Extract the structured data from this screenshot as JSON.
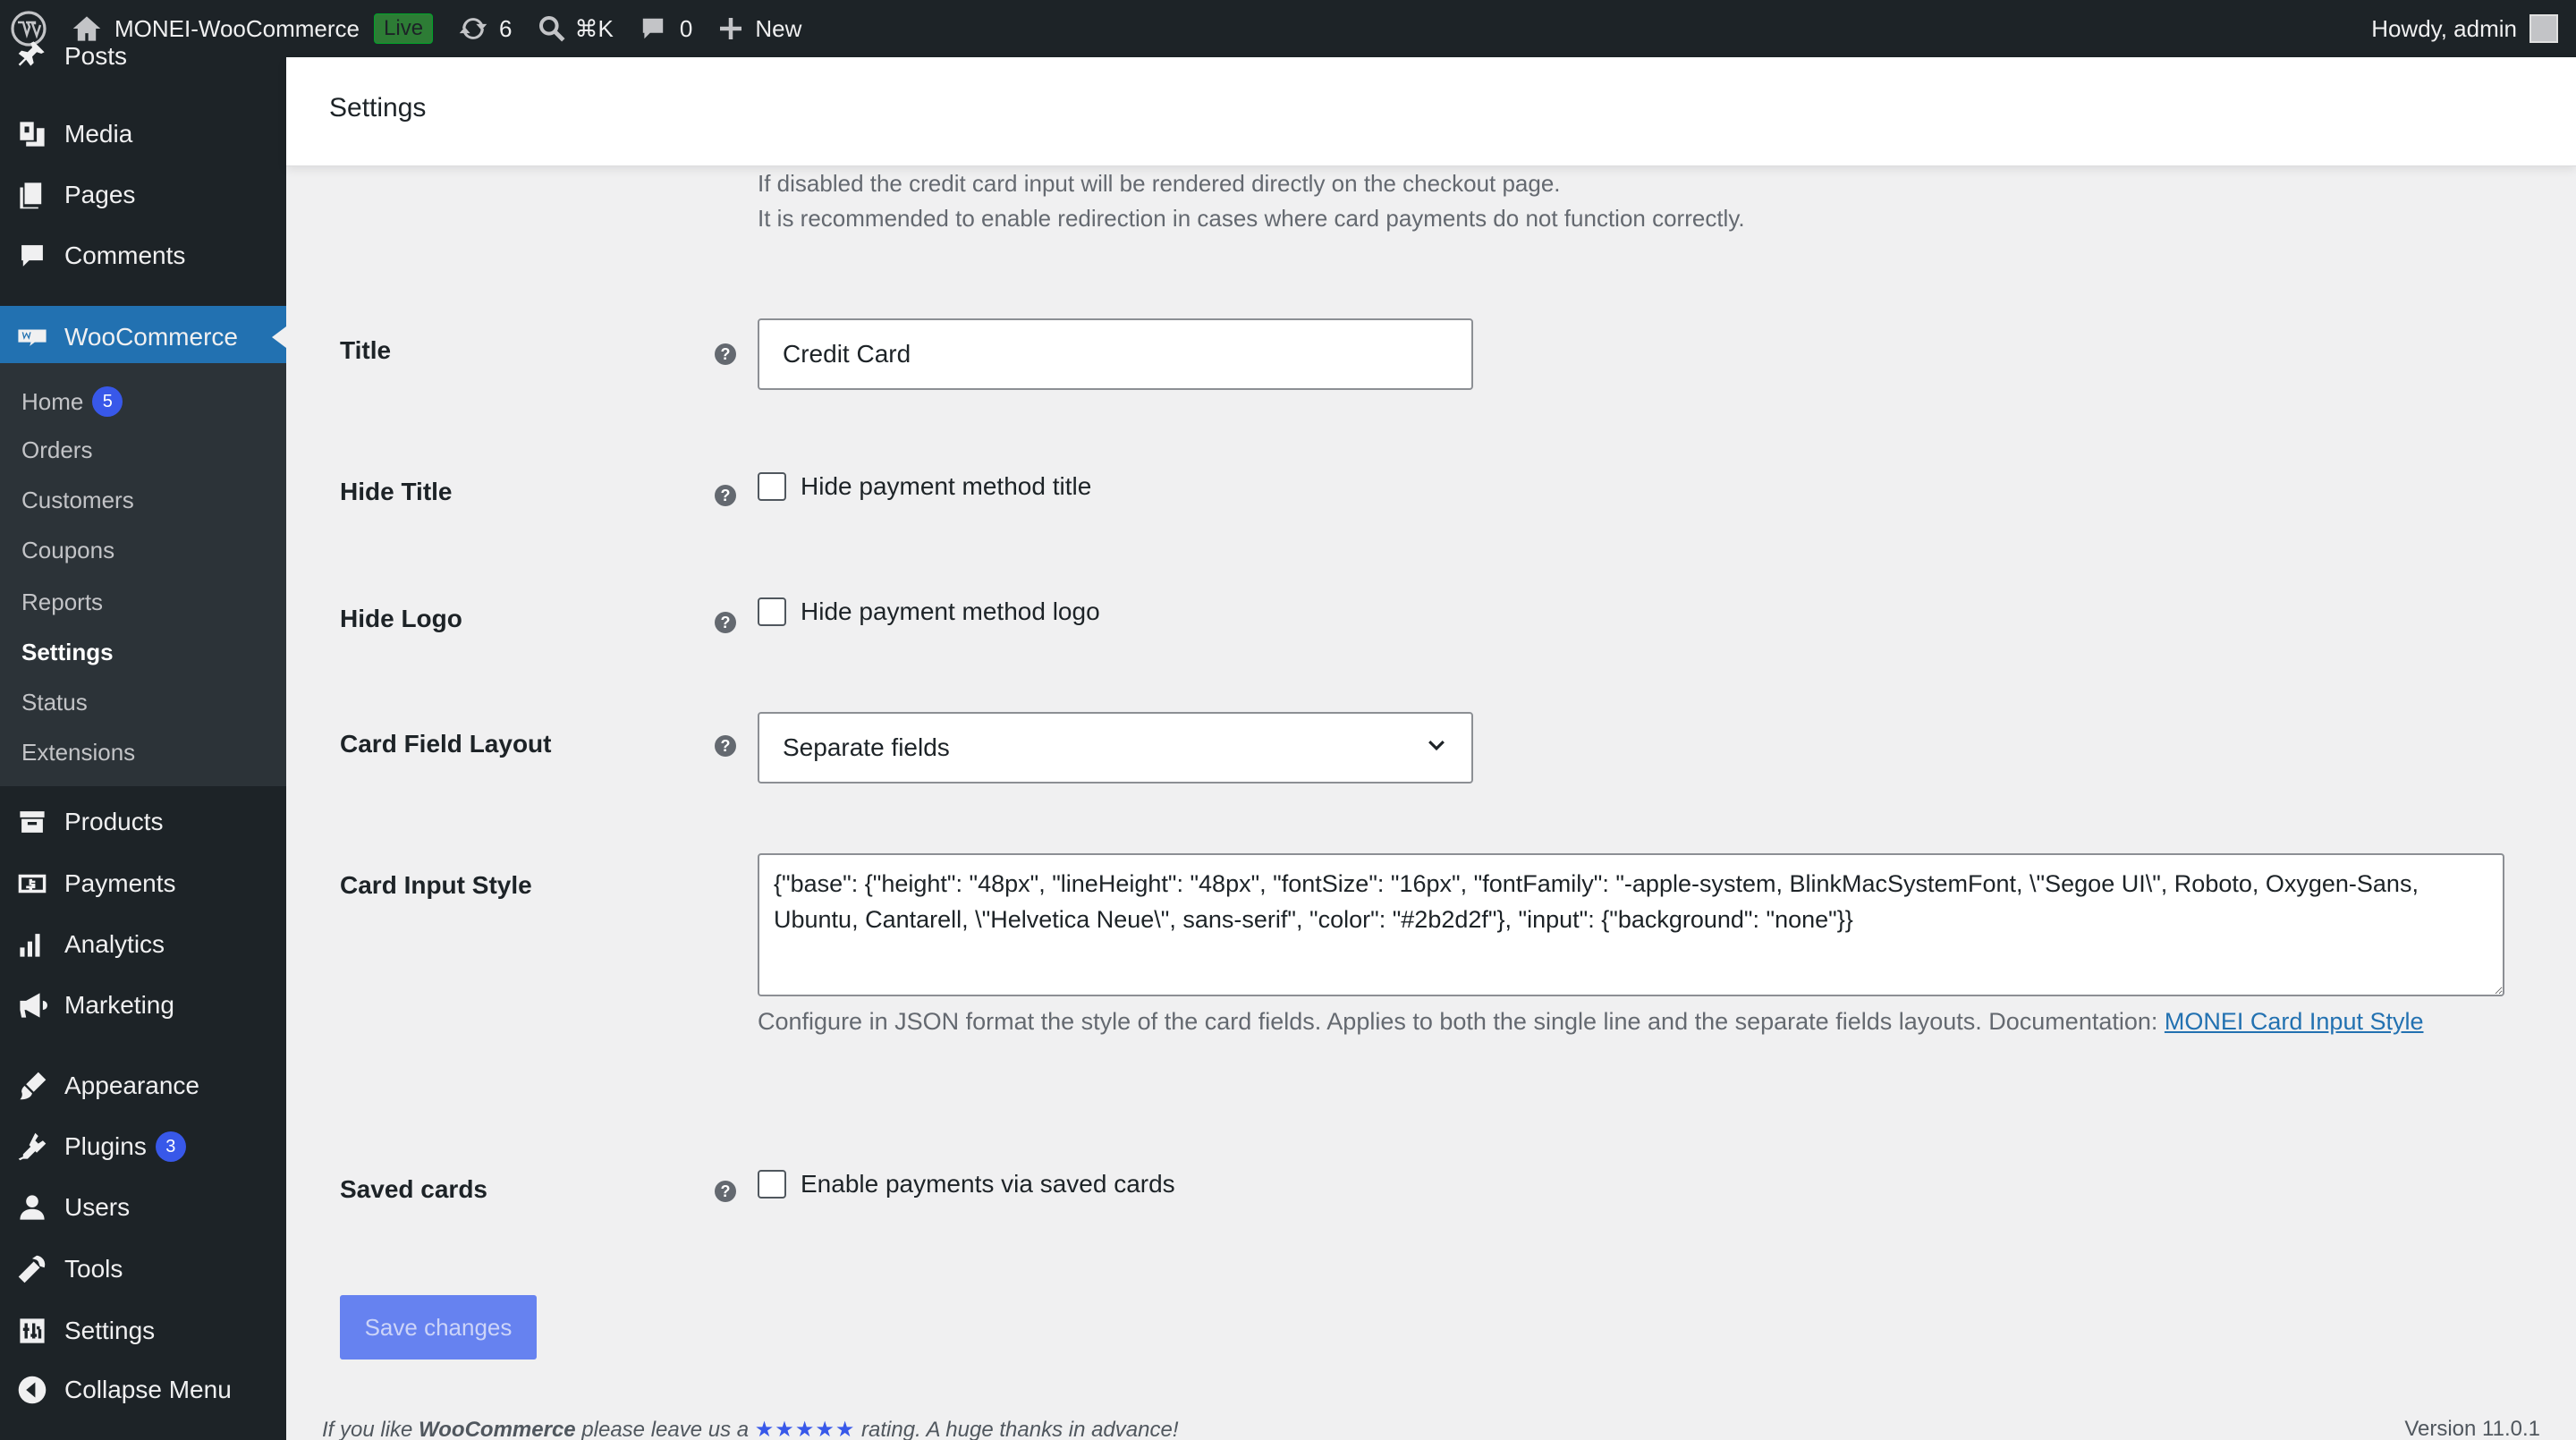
{
  "admin_bar": {
    "site_name": "MONEI-WooCommerce",
    "live_badge": "Live",
    "updates_count": "6",
    "search_shortcut": "⌘K",
    "comments_count": "0",
    "new_label": "New",
    "howdy": "Howdy, admin"
  },
  "sidebar": {
    "items": [
      {
        "label": "Posts",
        "icon": "pin-icon"
      },
      {
        "label": "Media",
        "icon": "media-icon"
      },
      {
        "label": "Pages",
        "icon": "pages-icon"
      },
      {
        "label": "Comments",
        "icon": "comment-icon"
      },
      {
        "label": "WooCommerce",
        "icon": "woo-icon"
      },
      {
        "label": "Products",
        "icon": "archive-icon"
      },
      {
        "label": "Payments",
        "icon": "payments-icon"
      },
      {
        "label": "Analytics",
        "icon": "chart-bar-icon"
      },
      {
        "label": "Marketing",
        "icon": "megaphone-icon"
      },
      {
        "label": "Appearance",
        "icon": "brush-icon"
      },
      {
        "label": "Plugins",
        "icon": "plugin-icon",
        "badge": "3"
      },
      {
        "label": "Users",
        "icon": "users-icon"
      },
      {
        "label": "Tools",
        "icon": "wrench-icon"
      },
      {
        "label": "Settings",
        "icon": "settings-icon"
      },
      {
        "label": "Collapse Menu",
        "icon": "collapse-icon"
      }
    ],
    "submenu": [
      {
        "label": "Home",
        "badge": "5"
      },
      {
        "label": "Orders"
      },
      {
        "label": "Customers"
      },
      {
        "label": "Coupons"
      },
      {
        "label": "Reports"
      },
      {
        "label": "Settings"
      },
      {
        "label": "Status"
      },
      {
        "label": "Extensions"
      }
    ]
  },
  "header": {
    "title": "Settings"
  },
  "form": {
    "redirect_desc_1": "If disabled the credit card input will be rendered directly on the checkout page.",
    "redirect_desc_2": "It is recommended to enable redirection in cases where card payments do not function correctly.",
    "title_label": "Title",
    "title_value": "Credit Card",
    "hide_title_label": "Hide Title",
    "hide_title_checkbox": "Hide payment method title",
    "hide_logo_label": "Hide Logo",
    "hide_logo_checkbox": "Hide payment method logo",
    "card_layout_label": "Card Field Layout",
    "card_layout_value": "Separate fields",
    "card_style_label": "Card Input Style",
    "card_style_value": "{\"base\": {\"height\": \"48px\", \"lineHeight\": \"48px\", \"fontSize\": \"16px\", \"fontFamily\": \"-apple-system, BlinkMacSystemFont, \\\"Segoe UI\\\", Roboto, Oxygen-Sans, Ubuntu, Cantarell, \\\"Helvetica Neue\\\", sans-serif\", \"color\": \"#2b2d2f\"}, \"input\": {\"background\": \"none\"}}",
    "card_style_desc": "Configure in JSON format the style of the card fields. Applies to both the single line and the separate fields layouts. Documentation: ",
    "card_style_link": "MONEI Card Input Style",
    "saved_cards_label": "Saved cards",
    "saved_cards_checkbox": "Enable payments via saved cards",
    "help_glyph": "?",
    "save_button": "Save changes"
  },
  "footer": {
    "text_1": "If you like ",
    "brand": "WooCommerce",
    "text_2": " please leave us a ",
    "stars": "★★★★★",
    "text_3": " rating. A huge thanks in advance!",
    "version": "Version 11.0.1"
  }
}
